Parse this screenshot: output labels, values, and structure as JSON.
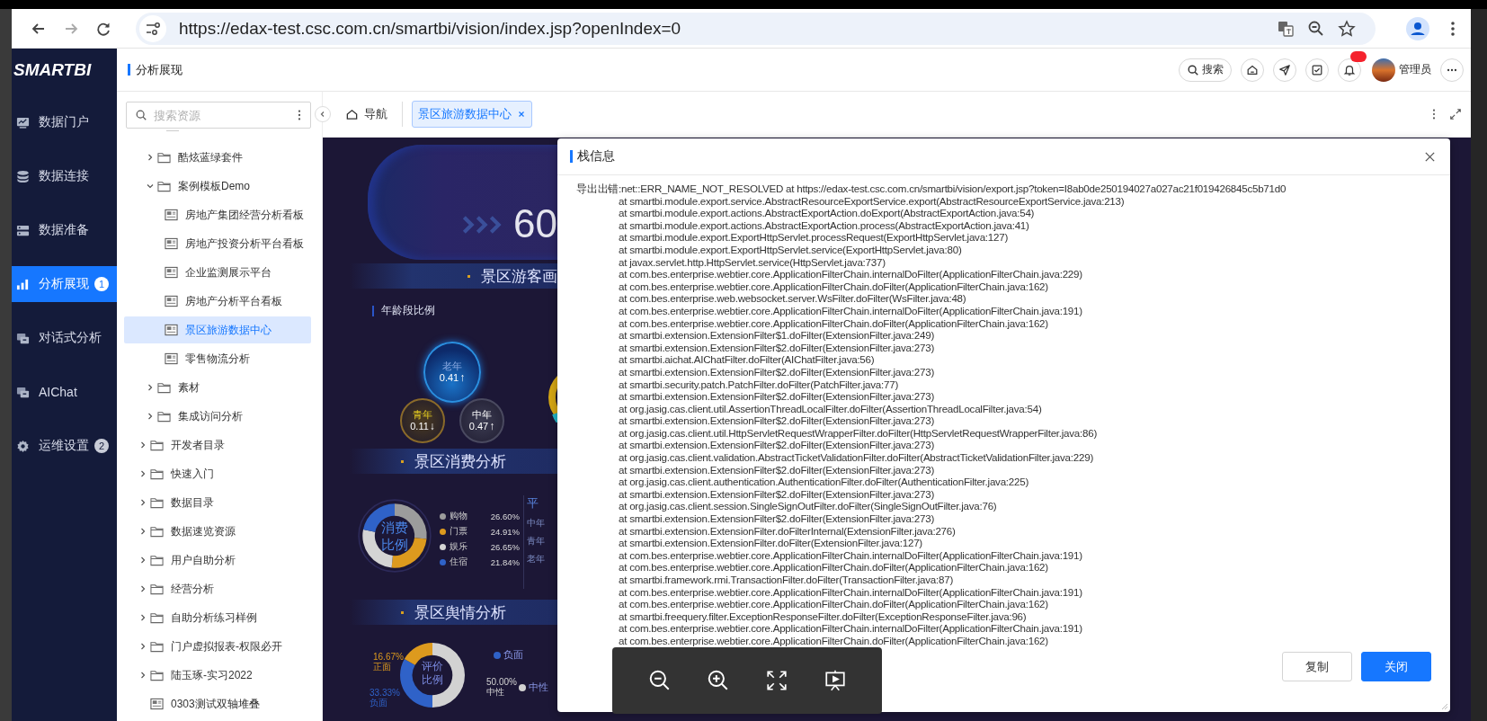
{
  "browser": {
    "url": "https://edax-test.csc.com.cn/smartbi/vision/index.jsp?openIndex=0"
  },
  "app": {
    "logo": "SMARTBI",
    "section_title": "分析展现",
    "search_label": "搜索",
    "user_name": "管理员",
    "has_notification": true
  },
  "nav": [
    {
      "label": "数据门户",
      "kind": "portal",
      "selected": false
    },
    {
      "label": "数据连接",
      "kind": "database",
      "selected": false
    },
    {
      "label": "数据准备",
      "kind": "prepare",
      "selected": false
    },
    {
      "label": "分析展现",
      "kind": "analysis",
      "selected": true,
      "badge": "1"
    },
    {
      "label": "对话式分析",
      "kind": "chat",
      "selected": false
    },
    {
      "label": "AIChat",
      "kind": "chat",
      "selected": false
    },
    {
      "label": "运维设置",
      "kind": "settings",
      "selected": false,
      "badge": "2"
    }
  ],
  "tree": {
    "search_placeholder": "搜索资源",
    "nested_items": [
      {
        "label": "酷炫蓝绿套件",
        "kind": "folder",
        "expanded": false,
        "selected": false
      },
      {
        "label": "案例模板Demo",
        "kind": "folder",
        "expanded": true,
        "selected": false,
        "children": [
          {
            "label": "房地产集团经营分析看板",
            "kind": "report",
            "selected": false
          },
          {
            "label": "房地产投资分析平台看板",
            "kind": "report",
            "selected": false
          },
          {
            "label": "企业监测展示平台",
            "kind": "report",
            "selected": false
          },
          {
            "label": "房地产分析平台看板",
            "kind": "report",
            "selected": false
          },
          {
            "label": "景区旅游数据中心",
            "kind": "report",
            "selected": true
          },
          {
            "label": "零售物流分析",
            "kind": "report",
            "selected": false
          }
        ]
      },
      {
        "label": "素材",
        "kind": "folder",
        "expanded": false,
        "selected": false
      },
      {
        "label": "集成访问分析",
        "kind": "folder",
        "expanded": false,
        "selected": false
      }
    ],
    "items": [
      {
        "label": "开发者目录",
        "kind": "folder",
        "expanded": false,
        "selected": false
      },
      {
        "label": "快速入门",
        "kind": "folder",
        "expanded": false,
        "selected": false
      },
      {
        "label": "数据目录",
        "kind": "folder",
        "expanded": false,
        "selected": false
      },
      {
        "label": "数据速览资源",
        "kind": "folder",
        "expanded": false,
        "selected": false
      },
      {
        "label": "用户自助分析",
        "kind": "folder",
        "expanded": false,
        "selected": false
      },
      {
        "label": "经营分析",
        "kind": "folder",
        "expanded": false,
        "selected": false
      },
      {
        "label": "自助分析练习样例",
        "kind": "folder",
        "expanded": false,
        "selected": false
      },
      {
        "label": "门户虚拟报表-权限必开",
        "kind": "folder",
        "expanded": false,
        "selected": false
      },
      {
        "label": "陆玉琢-实习2022",
        "kind": "folder",
        "expanded": false,
        "selected": false
      },
      {
        "label": "0303测试双轴堆叠",
        "kind": "report",
        "selected": false
      }
    ]
  },
  "tabs": [
    {
      "label": "导航",
      "kind": "home",
      "selected": false
    },
    {
      "label": "景区旅游数据中心",
      "kind": "page",
      "selected": true
    }
  ],
  "dashboard": {
    "kpi": "60",
    "visitor_title": "景区游客画",
    "age": {
      "title": "年龄段比例",
      "groups": [
        {
          "label": "老年",
          "value": "0.41",
          "arrow": "↑",
          "kind": "large"
        },
        {
          "label": "青年",
          "value": "0.11",
          "arrow": "↓",
          "kind": "gold"
        },
        {
          "label": "中年",
          "value": "0.47",
          "arrow": "↑",
          "kind": "gray"
        }
      ]
    },
    "consumption": {
      "title": "景区消费分析",
      "side_title": "平",
      "side_labels": [
        "中年",
        "青年",
        "老年"
      ],
      "chart_data": {
        "type": "donut",
        "title": "消费比例",
        "categories": [
          "购物",
          "门票",
          "娱乐",
          "住宿"
        ],
        "values": [
          26.6,
          24.91,
          26.65,
          21.84
        ],
        "value_labels": [
          "26.60%",
          "24.91%",
          "26.65%",
          "21.84%"
        ],
        "colors": [
          "#9c9c9c",
          "#dd9a1e",
          "#d4d4d4",
          "#2f62c8"
        ]
      }
    },
    "sentiment": {
      "title": "景区舆情分析",
      "legend": [
        {
          "label": "负面",
          "color": "#2f62c8"
        },
        {
          "label": "中性",
          "color": "#d2d2d2"
        }
      ],
      "chart_data": {
        "type": "donut",
        "title": "评价比例",
        "categories": [
          "中性",
          "负面",
          "正面"
        ],
        "values": [
          50.0,
          33.33,
          16.67
        ],
        "value_labels": [
          "50.00%",
          "33.33%",
          "16.67%"
        ],
        "colors": [
          "#d2d2d2",
          "#2f62c8",
          "#dd9a1e"
        ]
      }
    }
  },
  "dialog": {
    "title": "栈信息",
    "lines": [
      {
        "kind": "message",
        "text": "导出出错:net::ERR_NAME_NOT_RESOLVED at https://edax-test.csc.com.cn/smartbi/vision/export.jsp?token=I8ab0de250194027a027ac21f019426845c5b71d0"
      },
      {
        "kind": "frame",
        "text": "at smartbi.module.export.service.AbstractResourceExportService.export(AbstractResourceExportService.java:213)"
      },
      {
        "kind": "frame",
        "text": "at smartbi.module.export.actions.AbstractExportAction.doExport(AbstractExportAction.java:54)"
      },
      {
        "kind": "frame",
        "text": "at smartbi.module.export.actions.AbstractExportAction.process(AbstractExportAction.java:41)"
      },
      {
        "kind": "frame",
        "text": "at smartbi.module.export.ExportHttpServlet.processRequest(ExportHttpServlet.java:127)"
      },
      {
        "kind": "frame",
        "text": "at smartbi.module.export.ExportHttpServlet.service(ExportHttpServlet.java:80)"
      },
      {
        "kind": "frame",
        "text": "at javax.servlet.http.HttpServlet.service(HttpServlet.java:737)"
      },
      {
        "kind": "frame",
        "text": "at com.bes.enterprise.webtier.core.ApplicationFilterChain.internalDoFilter(ApplicationFilterChain.java:229)"
      },
      {
        "kind": "frame",
        "text": "at com.bes.enterprise.webtier.core.ApplicationFilterChain.doFilter(ApplicationFilterChain.java:162)"
      },
      {
        "kind": "frame",
        "text": "at com.bes.enterprise.web.websocket.server.WsFilter.doFilter(WsFilter.java:48)"
      },
      {
        "kind": "frame",
        "text": "at com.bes.enterprise.webtier.core.ApplicationFilterChain.internalDoFilter(ApplicationFilterChain.java:191)"
      },
      {
        "kind": "frame",
        "text": "at com.bes.enterprise.webtier.core.ApplicationFilterChain.doFilter(ApplicationFilterChain.java:162)"
      },
      {
        "kind": "frame",
        "text": "at smartbi.extension.ExtensionFilter$1.doFilter(ExtensionFilter.java:249)"
      },
      {
        "kind": "frame",
        "text": "at smartbi.extension.ExtensionFilter$2.doFilter(ExtensionFilter.java:273)"
      },
      {
        "kind": "frame",
        "text": "at smartbi.aichat.AIChatFilter.doFilter(AIChatFilter.java:56)"
      },
      {
        "kind": "frame",
        "text": "at smartbi.extension.ExtensionFilter$2.doFilter(ExtensionFilter.java:273)"
      },
      {
        "kind": "frame",
        "text": "at smartbi.security.patch.PatchFilter.doFilter(PatchFilter.java:77)"
      },
      {
        "kind": "frame",
        "text": "at smartbi.extension.ExtensionFilter$2.doFilter(ExtensionFilter.java:273)"
      },
      {
        "kind": "frame",
        "text": "at org.jasig.cas.client.util.AssertionThreadLocalFilter.doFilter(AssertionThreadLocalFilter.java:54)"
      },
      {
        "kind": "frame",
        "text": "at smartbi.extension.ExtensionFilter$2.doFilter(ExtensionFilter.java:273)"
      },
      {
        "kind": "frame",
        "text": "at org.jasig.cas.client.util.HttpServletRequestWrapperFilter.doFilter(HttpServletRequestWrapperFilter.java:86)"
      },
      {
        "kind": "frame",
        "text": "at smartbi.extension.ExtensionFilter$2.doFilter(ExtensionFilter.java:273)"
      },
      {
        "kind": "frame",
        "text": "at org.jasig.cas.client.validation.AbstractTicketValidationFilter.doFilter(AbstractTicketValidationFilter.java:229)"
      },
      {
        "kind": "frame",
        "text": "at smartbi.extension.ExtensionFilter$2.doFilter(ExtensionFilter.java:273)"
      },
      {
        "kind": "frame",
        "text": "at org.jasig.cas.client.authentication.AuthenticationFilter.doFilter(AuthenticationFilter.java:225)"
      },
      {
        "kind": "frame",
        "text": "at smartbi.extension.ExtensionFilter$2.doFilter(ExtensionFilter.java:273)"
      },
      {
        "kind": "frame",
        "text": "at org.jasig.cas.client.session.SingleSignOutFilter.doFilter(SingleSignOutFilter.java:76)"
      },
      {
        "kind": "frame",
        "text": "at smartbi.extension.ExtensionFilter$2.doFilter(ExtensionFilter.java:273)"
      },
      {
        "kind": "frame",
        "text": "at smartbi.extension.ExtensionFilter.doFilterInternal(ExtensionFilter.java:276)"
      },
      {
        "kind": "frame",
        "text": "at smartbi.extension.ExtensionFilter.doFilter(ExtensionFilter.java:127)"
      },
      {
        "kind": "frame",
        "text": "at com.bes.enterprise.webtier.core.ApplicationFilterChain.internalDoFilter(ApplicationFilterChain.java:191)"
      },
      {
        "kind": "frame",
        "text": "at com.bes.enterprise.webtier.core.ApplicationFilterChain.doFilter(ApplicationFilterChain.java:162)"
      },
      {
        "kind": "frame",
        "text": "at smartbi.framework.rmi.TransactionFilter.doFilter(TransactionFilter.java:87)"
      },
      {
        "kind": "frame",
        "text": "at com.bes.enterprise.webtier.core.ApplicationFilterChain.internalDoFilter(ApplicationFilterChain.java:191)"
      },
      {
        "kind": "frame",
        "text": "at com.bes.enterprise.webtier.core.ApplicationFilterChain.doFilter(ApplicationFilterChain.java:162)"
      },
      {
        "kind": "frame",
        "text": "at smartbi.freequery.filter.ExceptionResponseFilter.doFilter(ExceptionResponseFilter.java:96)"
      },
      {
        "kind": "frame",
        "text": "at com.bes.enterprise.webtier.core.ApplicationFilterChain.internalDoFilter(ApplicationFilterChain.java:191)"
      },
      {
        "kind": "frame",
        "text": "at com.bes.enterprise.webtier.core.ApplicationFilterChain.doFilter(ApplicationFilterChain.java:162)"
      }
    ],
    "buttons": [
      {
        "label": "复制",
        "kind": "default"
      },
      {
        "label": "关闭",
        "kind": "primary"
      }
    ]
  }
}
